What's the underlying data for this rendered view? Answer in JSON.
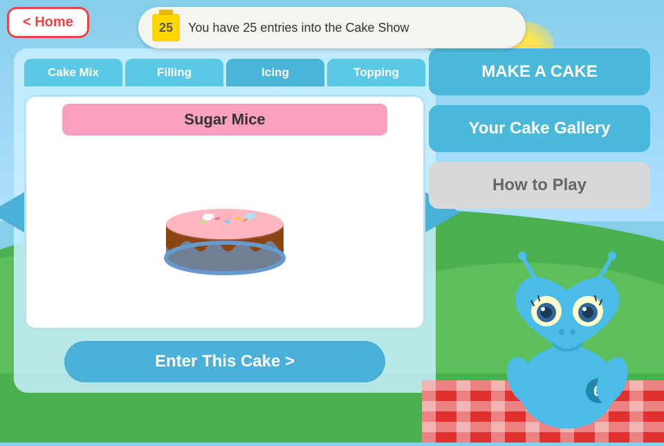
{
  "home": {
    "label": "< Home"
  },
  "banner": {
    "count": "25",
    "text": "You have 25 entries into the Cake Show"
  },
  "tabs": [
    {
      "id": "cake-mix",
      "label": "Cake Mix",
      "active": false
    },
    {
      "id": "filling",
      "label": "Filling",
      "active": false
    },
    {
      "id": "icing",
      "label": "Icing",
      "active": true
    },
    {
      "id": "topping",
      "label": "Topping",
      "active": false
    }
  ],
  "cake": {
    "name": "Sugar Mice"
  },
  "enter_btn": {
    "label": "Enter This Cake >"
  },
  "right_buttons": {
    "make_cake": "MAKE A CAKE",
    "gallery": "Your Cake Gallery",
    "how_to_play": "How to Play"
  }
}
